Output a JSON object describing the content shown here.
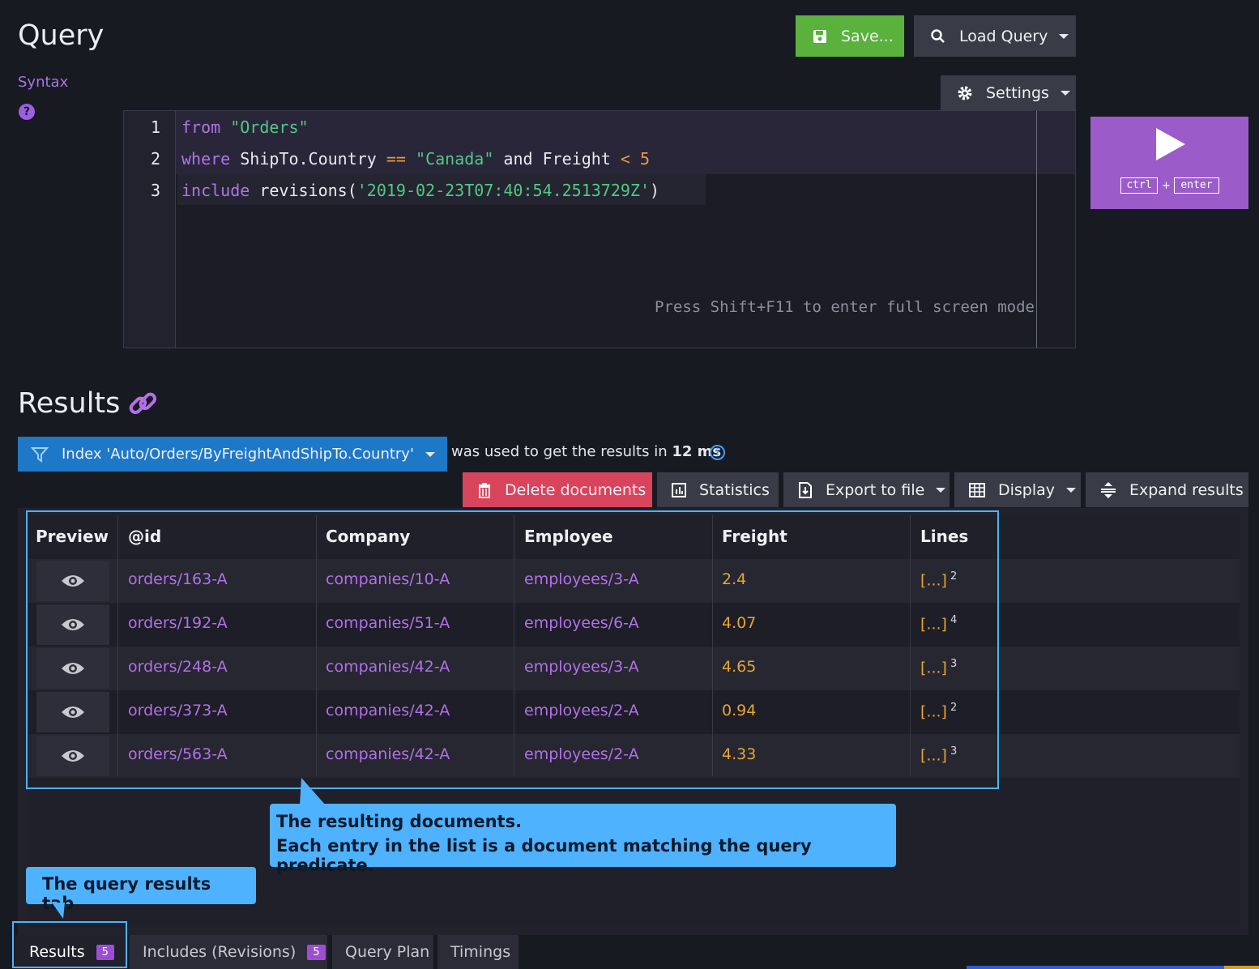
{
  "header": {
    "title": "Query",
    "syntax_link": "Syntax",
    "help_icon": "?",
    "save_label": "Save...",
    "load_label": "Load Query",
    "settings_label": "Settings"
  },
  "editor": {
    "lines": [
      "1",
      "2",
      "3"
    ],
    "line1": {
      "kw": "from",
      "str": "\"Orders\""
    },
    "line2": {
      "kw": "where",
      "field": "ShipTo.Country",
      "op1": "==",
      "str": "\"Canada\"",
      "and": "and",
      "field2": "Freight",
      "op2": "<",
      "num": "5"
    },
    "line3": {
      "kw": "include",
      "fn": "revisions(",
      "str": "'2019-02-23T07:40:54.2513729Z'",
      "close": ")"
    },
    "hint": "Press Shift+F11 to enter full screen mode"
  },
  "run": {
    "key1": "ctrl",
    "plus": "+",
    "key2": "enter"
  },
  "results": {
    "title": "Results",
    "index_label": "Index 'Auto/Orders/ByFreightAndShipTo.Country'",
    "note_prefix": "was used to get the results in ",
    "note_time": "12 ms",
    "info_icon": "i"
  },
  "toolbar": {
    "delete": "Delete documents",
    "statistics": "Statistics",
    "export": "Export to file",
    "display": "Display",
    "expand": "Expand results"
  },
  "table": {
    "columns": [
      "Preview",
      "@id",
      "Company",
      "Employee",
      "Freight",
      "Lines"
    ],
    "rows": [
      {
        "id": "orders/163-A",
        "company": "companies/10-A",
        "employee": "employees/3-A",
        "freight": "2.4",
        "lines": "[...]",
        "count": "2"
      },
      {
        "id": "orders/192-A",
        "company": "companies/51-A",
        "employee": "employees/6-A",
        "freight": "4.07",
        "lines": "[...]",
        "count": "4"
      },
      {
        "id": "orders/248-A",
        "company": "companies/42-A",
        "employee": "employees/3-A",
        "freight": "4.65",
        "lines": "[...]",
        "count": "3"
      },
      {
        "id": "orders/373-A",
        "company": "companies/42-A",
        "employee": "employees/2-A",
        "freight": "0.94",
        "lines": "[...]",
        "count": "2"
      },
      {
        "id": "orders/563-A",
        "company": "companies/42-A",
        "employee": "employees/2-A",
        "freight": "4.33",
        "lines": "[...]",
        "count": "3"
      }
    ]
  },
  "callouts": {
    "docs_line1": "The resulting documents.",
    "docs_line2": "Each entry in the list is a document matching the query predicate.",
    "tab_note": "The query results tab"
  },
  "tabs": [
    {
      "label": "Results",
      "badge": "5"
    },
    {
      "label": "Includes (Revisions)",
      "badge": "5"
    },
    {
      "label": "Query Plan"
    },
    {
      "label": "Timings"
    }
  ],
  "colors": {
    "accent": "#9b5cc9",
    "save": "#5ab13c",
    "index": "#1e78c8",
    "delete": "#d9445d",
    "callout": "#4fb2ff"
  }
}
